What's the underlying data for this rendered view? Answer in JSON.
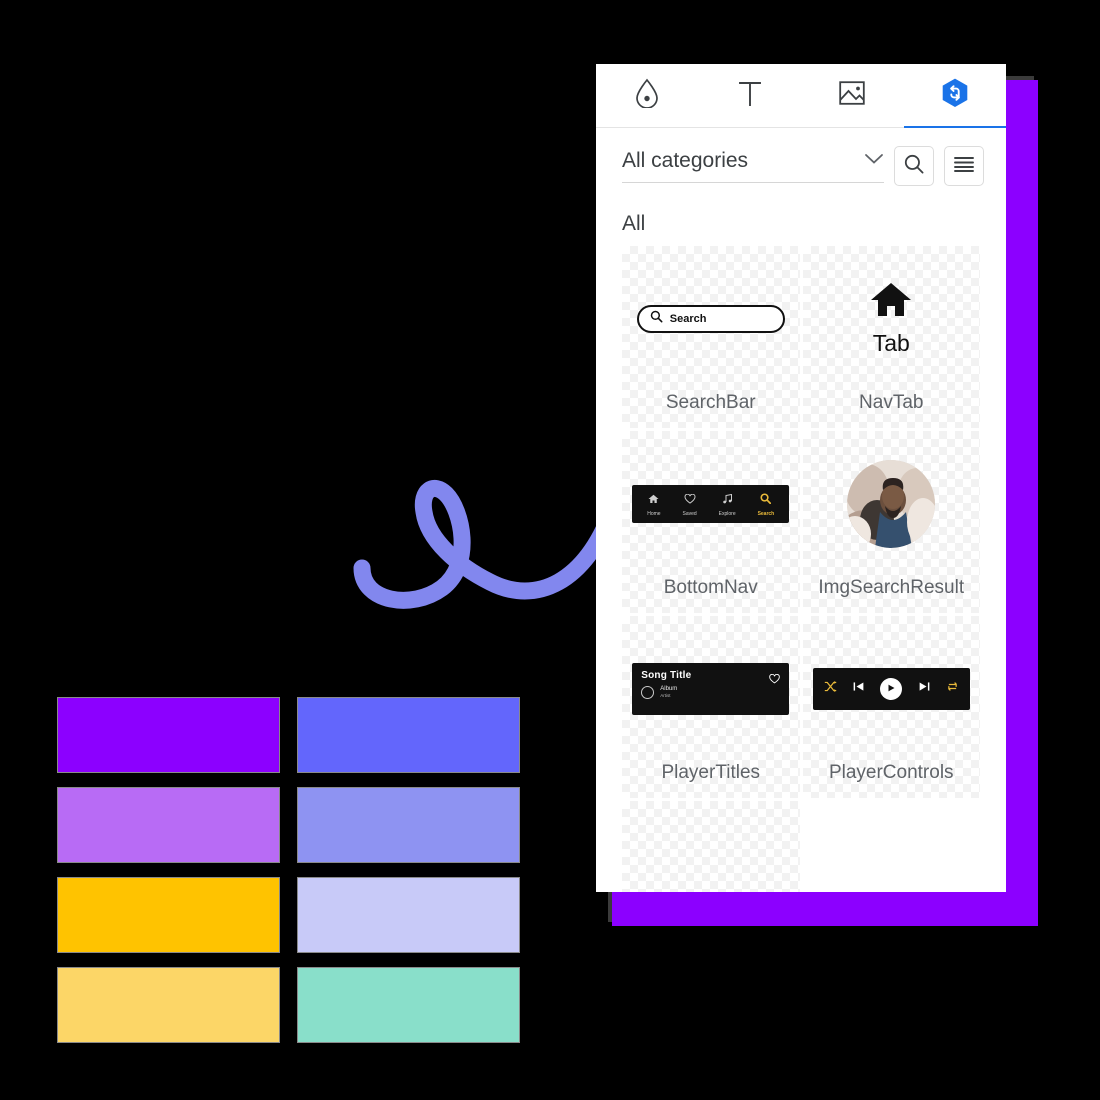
{
  "canvas": {
    "background": "#000000",
    "backdrop_card_color": "#8C00FF",
    "doodle_color": "#8287EE",
    "doodle_name": "cursive-loop-squiggle"
  },
  "palette": {
    "swatches": [
      {
        "name": "vivid-purple",
        "hex": "#8C00FF"
      },
      {
        "name": "periwinkle-blue",
        "hex": "#6366FC"
      },
      {
        "name": "light-purple",
        "hex": "#B86BF5"
      },
      {
        "name": "soft-indigo",
        "hex": "#8E93F2"
      },
      {
        "name": "amber",
        "hex": "#FFC300"
      },
      {
        "name": "lavender-mist",
        "hex": "#C8CAF8"
      },
      {
        "name": "light-gold",
        "hex": "#FCD667"
      },
      {
        "name": "mint-green",
        "hex": "#89DFCA"
      }
    ]
  },
  "panel": {
    "accent_color": "#1a73e8",
    "tabs": [
      {
        "id": "styles",
        "icon": "droplet-icon",
        "label": "",
        "active": false
      },
      {
        "id": "text",
        "icon": "text-t-icon",
        "label": "",
        "active": false
      },
      {
        "id": "images",
        "icon": "image-icon",
        "label": "",
        "active": false
      },
      {
        "id": "components",
        "icon": "hexagon-swap-icon",
        "label": "",
        "active": true
      }
    ],
    "category": {
      "selected": "All categories",
      "chevron_icon": "chevron-down-icon",
      "search_icon": "search-icon",
      "menu_icon": "hamburger-menu-icon"
    },
    "section_title": "All",
    "components": [
      {
        "name": "SearchBar",
        "preview": "search-pill"
      },
      {
        "name": "NavTab",
        "preview": "nav-tab"
      },
      {
        "name": "BottomNav",
        "preview": "bottom-nav"
      },
      {
        "name": "ImgSearchResult",
        "preview": "avatar-photo"
      },
      {
        "name": "PlayerTitles",
        "preview": "player-titles"
      },
      {
        "name": "PlayerControls",
        "preview": "player-controls"
      }
    ]
  },
  "previews": {
    "searchbar": {
      "placeholder": "Search",
      "icon": "search-icon"
    },
    "navtab": {
      "label": "Tab",
      "icon": "home-icon"
    },
    "bottomnav": {
      "background": "#111111",
      "active_color": "#E8B93A",
      "items": [
        {
          "label": "Home",
          "icon": "home-icon",
          "active": false
        },
        {
          "label": "Saved",
          "icon": "heart-icon",
          "active": false
        },
        {
          "label": "Explore",
          "icon": "music-icon",
          "active": false
        },
        {
          "label": "Search",
          "icon": "search-icon",
          "active": true
        }
      ]
    },
    "player_titles": {
      "title": "Song Title",
      "album": "Album",
      "artist": "Artist",
      "like_icon": "heart-icon",
      "background": "#111111"
    },
    "player_controls": {
      "background": "#111111",
      "accent": "#E8B93A",
      "buttons": [
        {
          "name": "shuffle-icon"
        },
        {
          "name": "previous-track-icon"
        },
        {
          "name": "play-icon"
        },
        {
          "name": "next-track-icon"
        },
        {
          "name": "repeat-icon"
        }
      ]
    }
  }
}
